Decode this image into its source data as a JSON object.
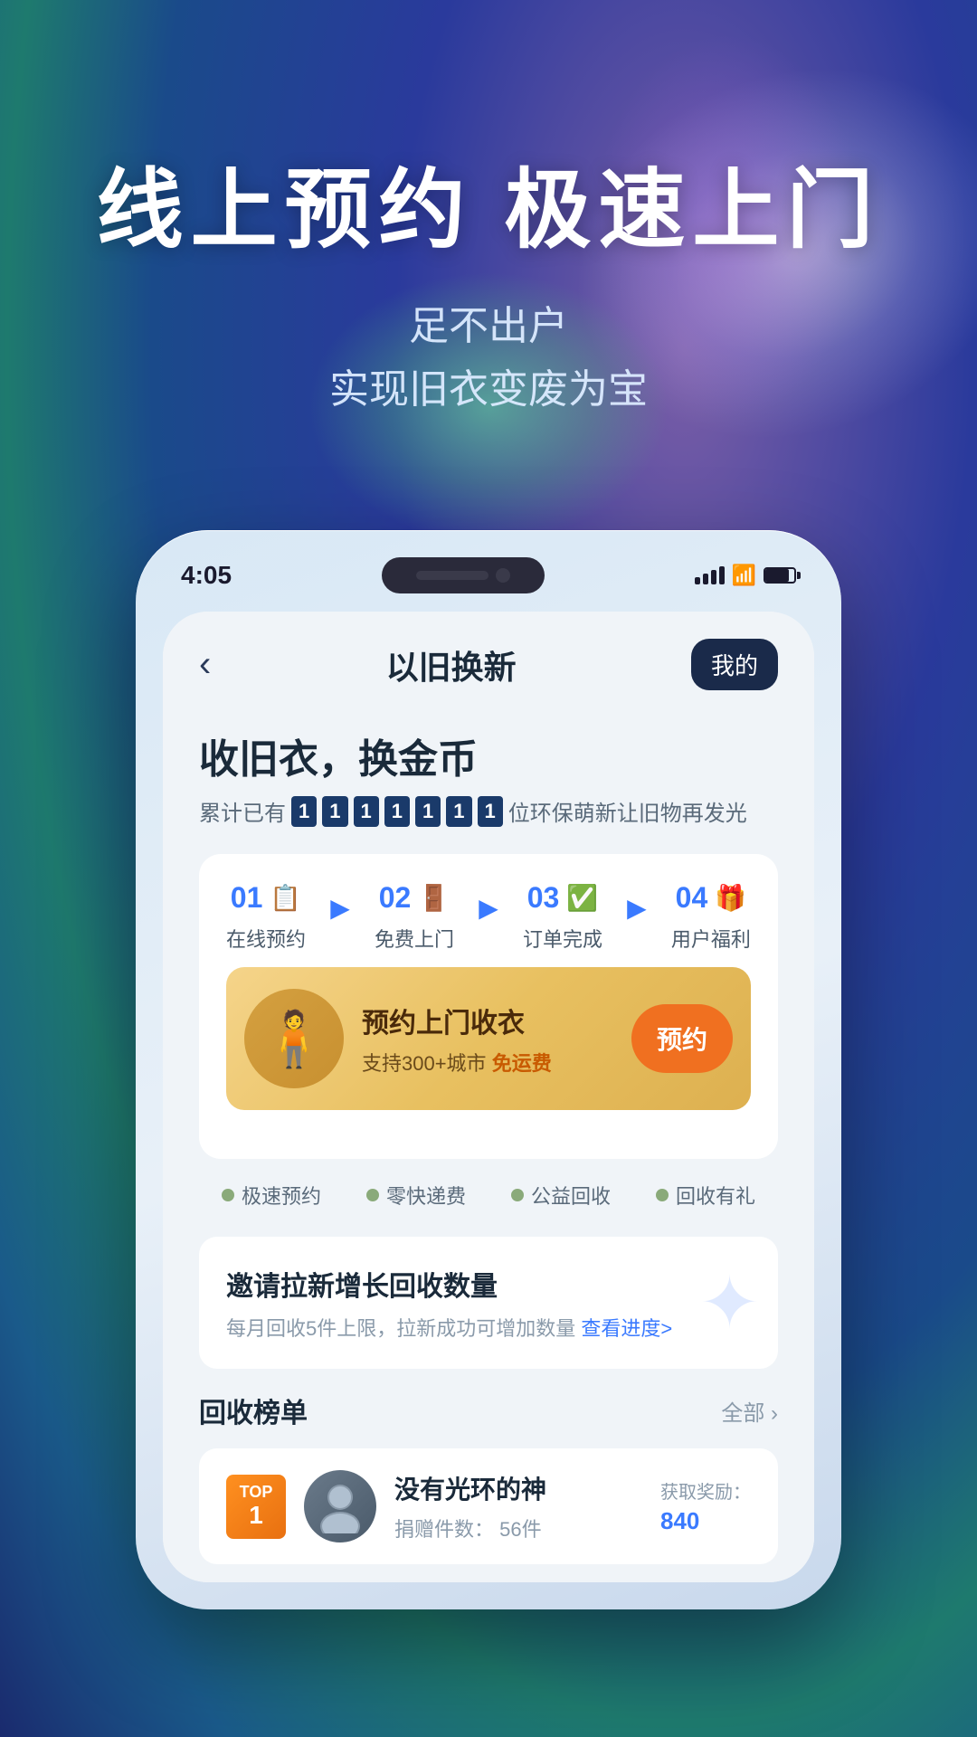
{
  "background": {
    "gradient_start": "#1a1a6e",
    "gradient_end": "#1a4a8a"
  },
  "hero": {
    "title": "线上预约 极速上门",
    "subtitle_line1": "足不出户",
    "subtitle_line2": "实现旧衣变废为宝"
  },
  "phone": {
    "status_bar": {
      "time": "4:05"
    },
    "header": {
      "back_label": "‹",
      "title": "以旧换新",
      "my_button": "我的"
    },
    "main": {
      "section_title": "收旧衣，换金币",
      "counter_prefix": "累计已有",
      "counter_digits": [
        "1",
        "1",
        "1",
        "1",
        "1",
        "1",
        "1"
      ],
      "counter_suffix": "位环保萌新让旧物再发光",
      "steps": [
        {
          "num": "01",
          "icon": "📋",
          "label": "在线预约"
        },
        {
          "num": "02",
          "icon": "🚪",
          "label": "免费上门"
        },
        {
          "num": "03",
          "icon": "✅",
          "label": "订单完成"
        },
        {
          "num": "04",
          "icon": "🎁",
          "label": "用户福利"
        }
      ],
      "banner": {
        "main_text": "预约上门收衣",
        "sub_text": "支持300+城市",
        "highlight": "免运费",
        "book_button": "预约"
      },
      "tags": [
        "极速预约",
        "零快递费",
        "公益回收",
        "回收有礼"
      ],
      "invite": {
        "title": "邀请拉新增长回收数量",
        "desc": "每月回收5件上限，拉新成功可增加数量",
        "link": "查看进度>"
      },
      "leaderboard": {
        "title": "回收榜单",
        "all_label": "全部 ›",
        "items": [
          {
            "rank_top": "TOP",
            "rank_num": "1",
            "name": "没有光环的神",
            "donations_label": "捐赠件数：",
            "donations_val": "56件",
            "reward_label": "获取奖励：",
            "reward_val": "840"
          }
        ]
      }
    }
  }
}
